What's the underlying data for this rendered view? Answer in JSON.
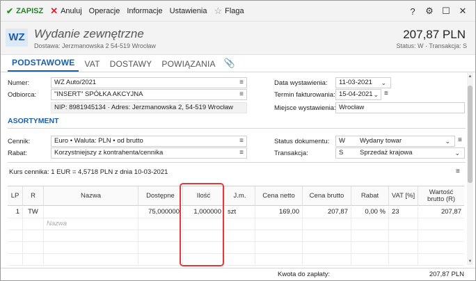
{
  "toolbar": {
    "save": "ZAPISZ",
    "cancel": "Anuluj",
    "operations": "Operacje",
    "info": "Informacje",
    "settings": "Ustawienia",
    "flag": "Flaga"
  },
  "header": {
    "badge": "WZ",
    "title": "Wydanie zewnętrzne",
    "subtitle": "Dostawa: Jerzmanowska 2 54-519 Wrocław",
    "amount": "207,87 PLN",
    "status": "Status: W · Transakcja: S"
  },
  "tabs": [
    "PODSTAWOWE",
    "VAT",
    "DOSTAWY",
    "POWIĄZANIA"
  ],
  "form": {
    "number_label": "Numer:",
    "number_value": "WZ Auto/2021",
    "recipient_label": "Odbiorca:",
    "recipient_value": "\"INSERT\" SPÓŁKA AKCYJNA",
    "recipient_details": "NIP: 8981945134 · Adres: Jerzmanowska 2, 54-519 Wrocław",
    "issue_date_label": "Data wystawienia:",
    "issue_date_value": "11-03-2021",
    "invoice_date_label": "Termin fakturowania:",
    "invoice_date_value": "15-04-2021",
    "place_label": "Miejsce wystawienia:",
    "place_value": "Wrocław"
  },
  "assortment": {
    "section_title": "ASORTYMENT",
    "pricelist_label": "Cennik:",
    "pricelist_value": "Euro • Waluta: PLN • od brutto",
    "discount_label": "Rabat:",
    "discount_value": "Korzystniejszy z kontrahenta/cennika",
    "doc_status_label": "Status dokumentu:",
    "doc_status_code": "W",
    "doc_status_value": "Wydany towar",
    "transaction_label": "Transakcja:",
    "transaction_code": "S",
    "transaction_value": "Sprzedaż krajowa",
    "rate_info": "Kurs cennika: 1 EUR = 4,5718 PLN z dnia 10-03-2021"
  },
  "grid": {
    "headers": [
      "LP",
      "R",
      "Nazwa",
      "Dostępne",
      "Ilość",
      "J.m.",
      "Cena netto",
      "Cena brutto",
      "Rabat",
      "VAT [%]",
      "Wartość brutto (R)"
    ],
    "row": {
      "lp": "1",
      "r": "TW",
      "name": "",
      "available": "75,000000",
      "qty": "1,000000",
      "unit": "szt",
      "net": "169,00",
      "gross": "207,87",
      "discount": "0,00 %",
      "vat": "23",
      "total": "207,87"
    },
    "name_placeholder": "Nazwa"
  },
  "footer": {
    "label": "Kwota do zapłaty:",
    "value": "207,87 PLN"
  }
}
